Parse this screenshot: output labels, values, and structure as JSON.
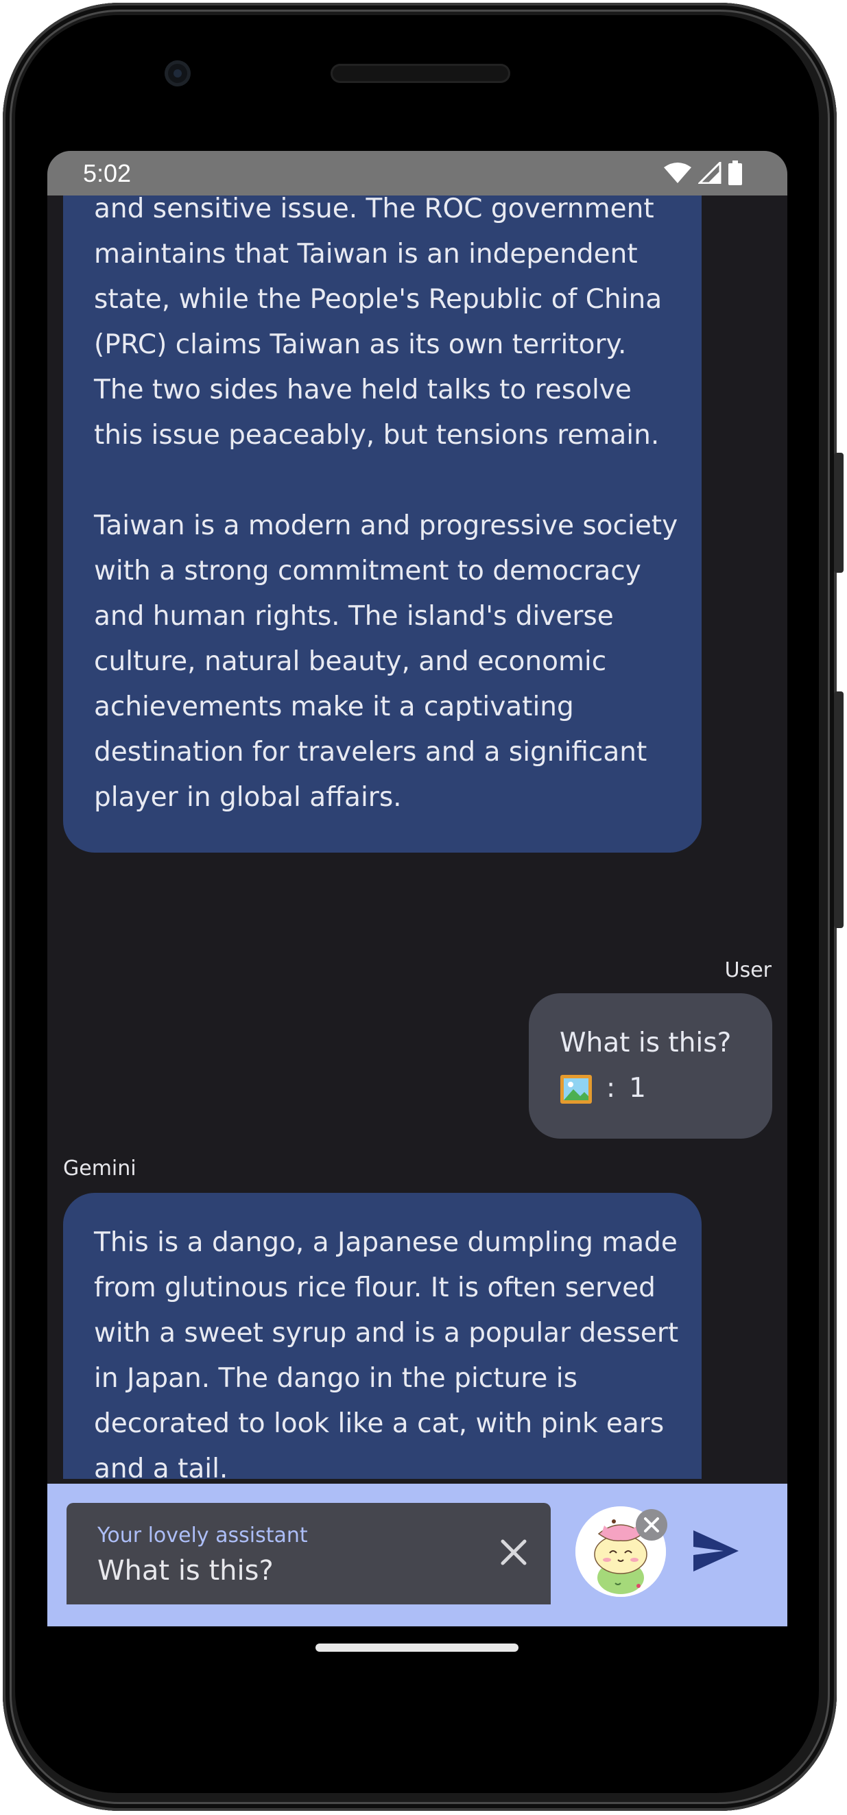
{
  "status_bar": {
    "time": "5:02"
  },
  "chat": {
    "messages": [
      {
        "role": "model",
        "paragraphs": [
          "and sensitive issue. The ROC government maintains that Taiwan is an independent state, while the People's Republic of China (PRC) claims Taiwan as its own territory. The two sides have held talks to resolve this issue peaceably, but tensions remain.",
          "Taiwan is a modern and progressive society with a strong commitment to democracy and human rights. The island's diverse culture, natural beauty, and economic achievements make it a captivating destination for travelers and a significant player in global affairs."
        ]
      },
      {
        "role_label": "User",
        "text": "What is this?",
        "image_separator": ":",
        "image_count": "1"
      },
      {
        "role_label": "Gemini",
        "text": "This is a dango, a Japanese dumpling made from glutinous rice flour. It is often served with a sweet syrup and is a popular dessert in Japan. The dango in the picture is decorated to look like a cat, with pink ears and a tail."
      }
    ]
  },
  "input": {
    "label": "Your lovely assistant",
    "value": "What is this?"
  },
  "icons": {
    "wifi": "wifi-icon",
    "signal": "signal-icon",
    "battery": "battery-icon",
    "image": "image-icon",
    "clear": "close-icon",
    "remove_attachment": "close-circle-icon",
    "send": "send-icon",
    "attachment_thumbnail": "dango-cat-thumbnail"
  },
  "colors": {
    "background": "#1c1b1f",
    "model_bubble": "#2e4273",
    "user_bubble": "#454752",
    "input_bar": "#adbef7",
    "text_field": "#45464e",
    "send_icon": "#22357a",
    "status_bar": "#757575"
  }
}
